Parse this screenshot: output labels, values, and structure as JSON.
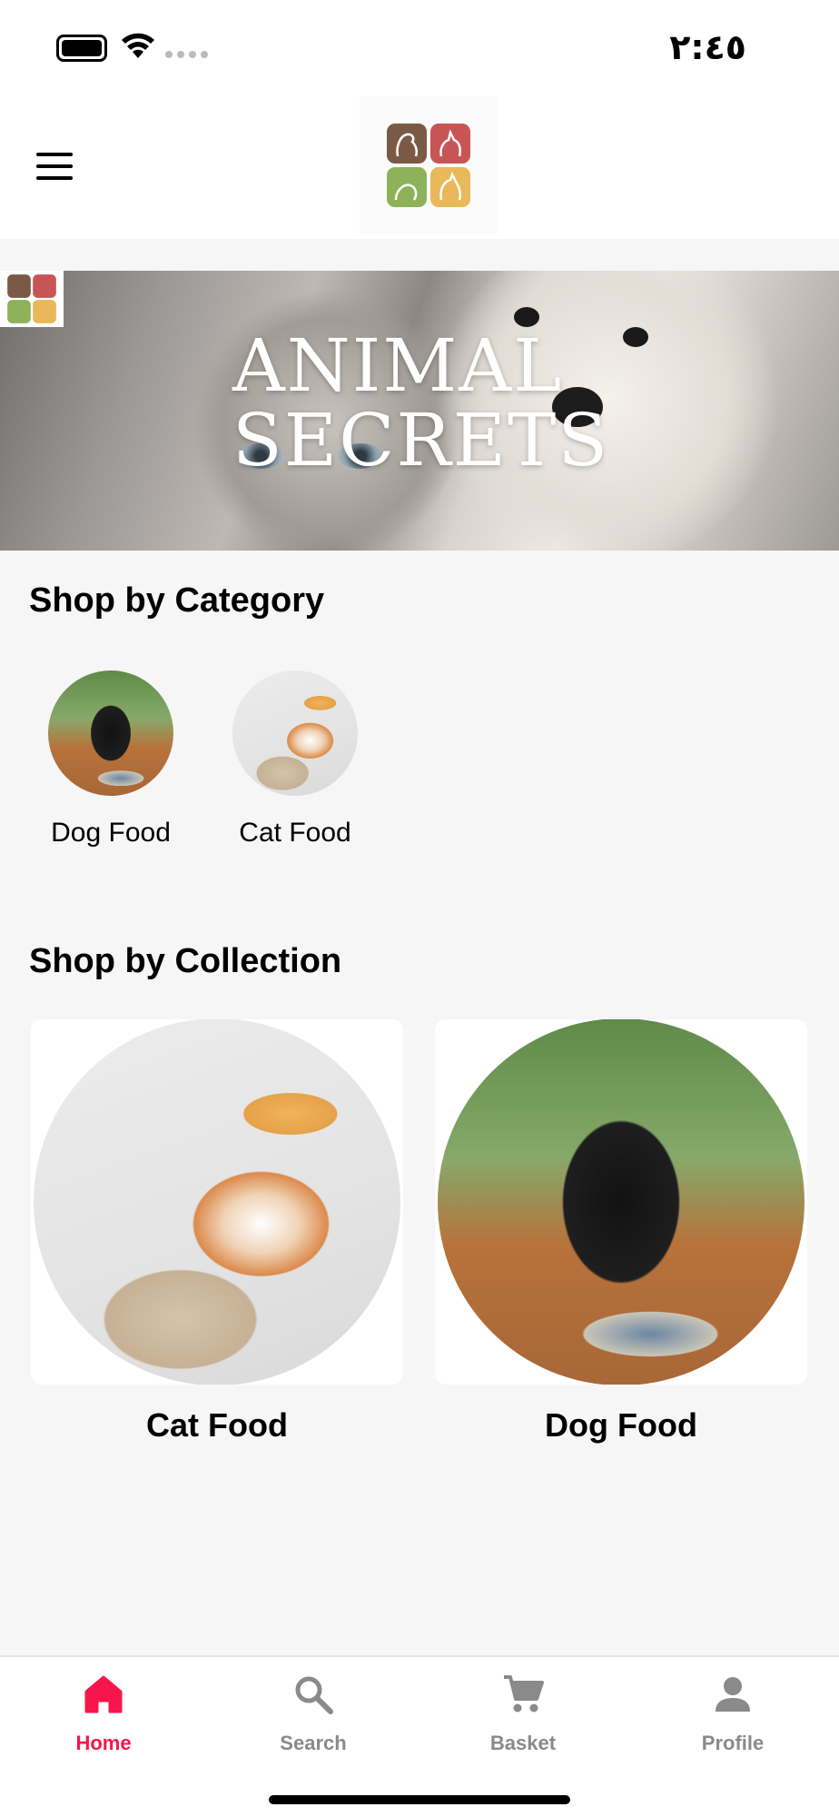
{
  "status_bar": {
    "time": "٢:٤٥"
  },
  "header": {
    "menu_icon": "hamburger-menu-icon",
    "logo": "animal-secrets-logo"
  },
  "banner": {
    "title_line1": "ANIMAL",
    "title_line2": "SECRETS",
    "badge_logo": "animal-secrets-logo"
  },
  "categories": {
    "title": "Shop by Category",
    "items": [
      {
        "label": "Dog Food"
      },
      {
        "label": "Cat Food"
      }
    ]
  },
  "collections": {
    "title": "Shop by Collection",
    "items": [
      {
        "label": "Cat Food"
      },
      {
        "label": "Dog Food"
      }
    ]
  },
  "bottom_nav": {
    "active_color": "#f6164b",
    "inactive_color": "#8a8a8a",
    "items": [
      {
        "label": "Home",
        "icon": "home-icon",
        "active": true
      },
      {
        "label": "Search",
        "icon": "search-icon",
        "active": false
      },
      {
        "label": "Basket",
        "icon": "cart-icon",
        "active": false
      },
      {
        "label": "Profile",
        "icon": "profile-icon",
        "active": false
      }
    ]
  },
  "logo_colors": {
    "brown": "#7b5a45",
    "red": "#c85555",
    "green": "#8db25a",
    "yellow": "#e8b85a"
  }
}
